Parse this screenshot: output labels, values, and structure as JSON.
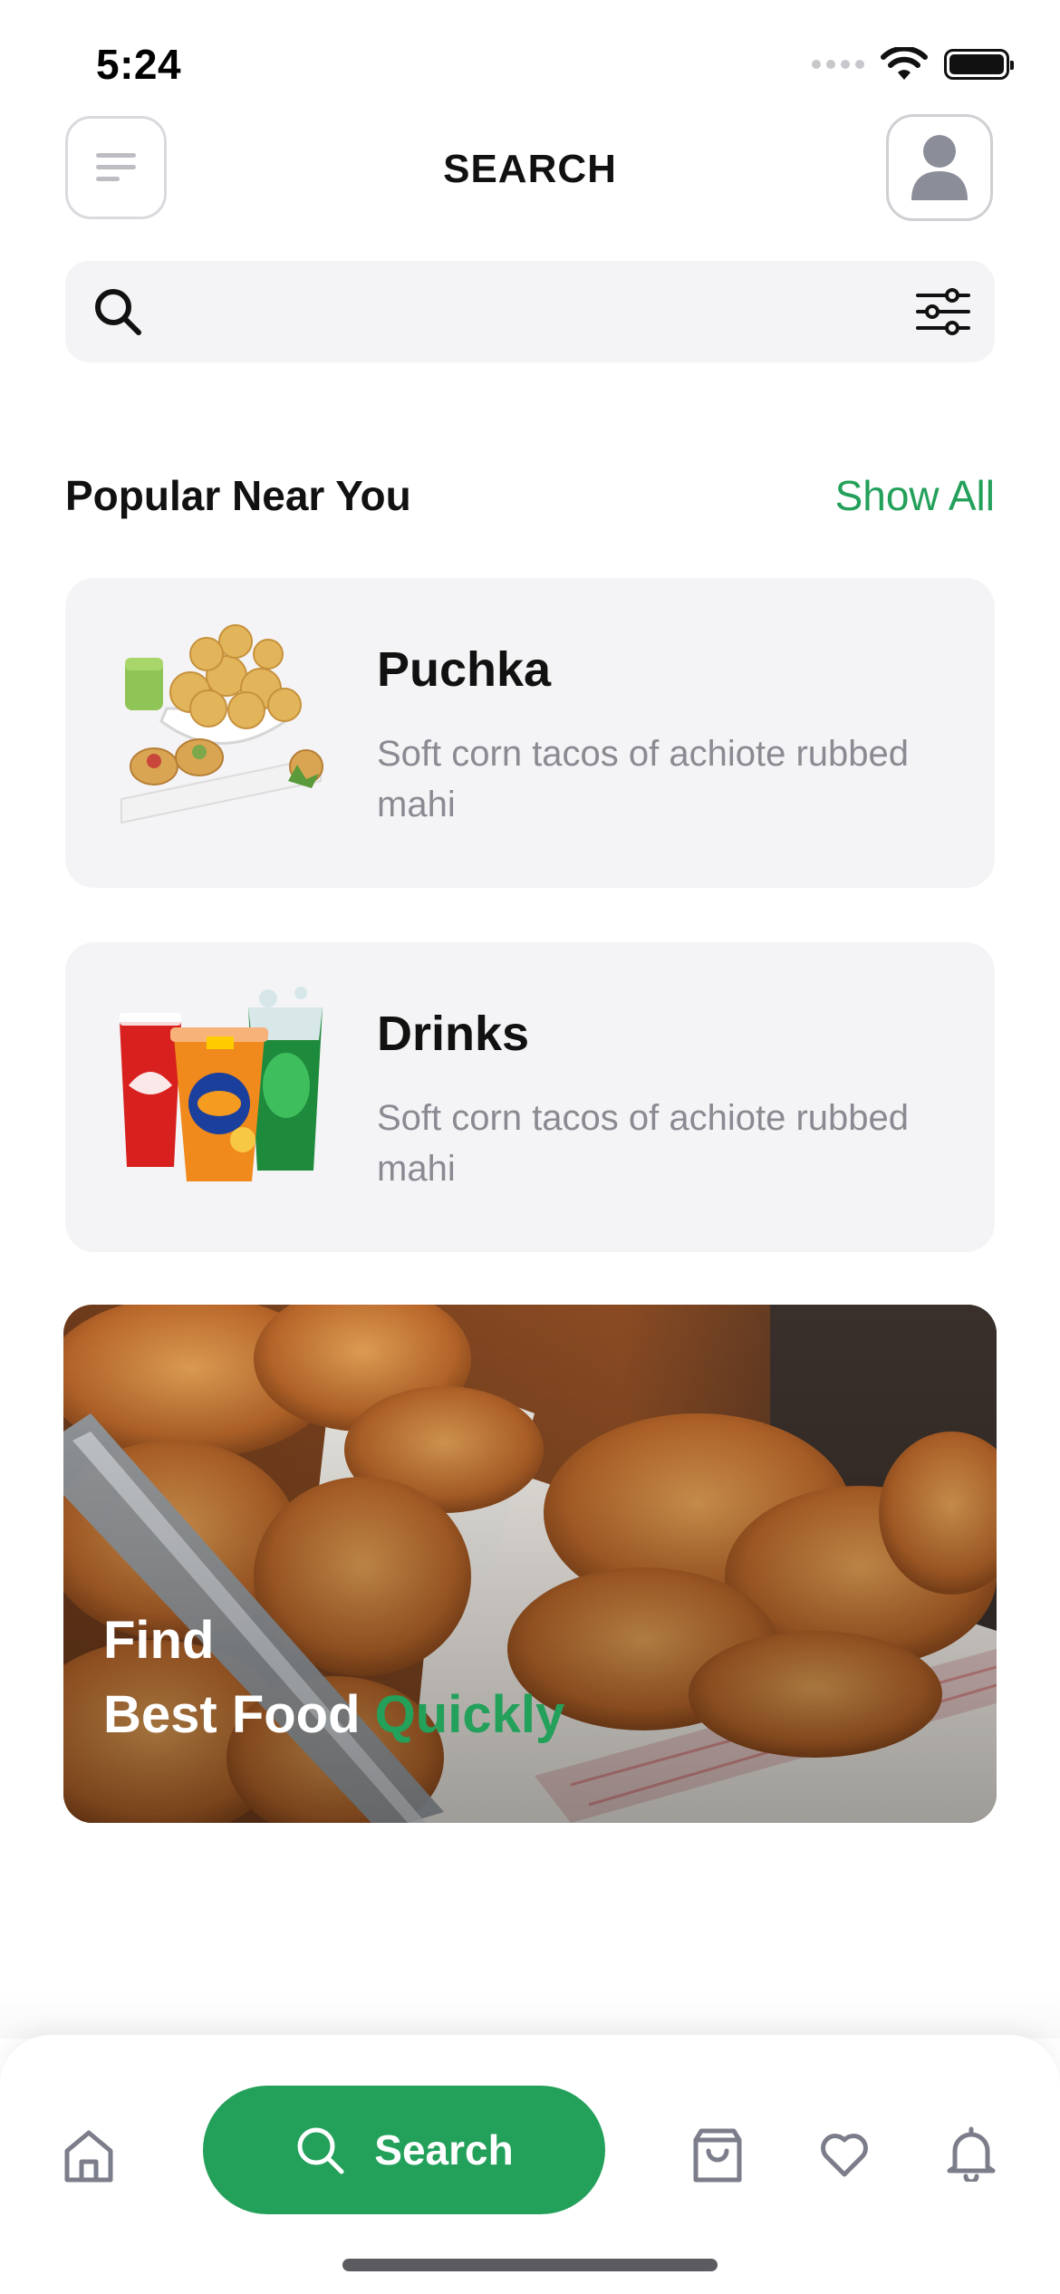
{
  "status_bar": {
    "time": "5:24"
  },
  "header": {
    "title": "SEARCH"
  },
  "search": {
    "placeholder": "",
    "value": ""
  },
  "section": {
    "title": "Popular Near You",
    "action": "Show All"
  },
  "items": [
    {
      "title": "Puchka",
      "description": "Soft corn tacos of achiote rubbed mahi"
    },
    {
      "title": "Drinks",
      "description": "Soft corn tacos of achiote rubbed mahi"
    }
  ],
  "promo": {
    "line1": "Find",
    "line2_prefix": "Best Food ",
    "line2_accent": "Quickly"
  },
  "nav": {
    "search_label": "Search"
  },
  "colors": {
    "accent": "#23a05a",
    "card_bg": "#f4f4f6",
    "muted_text": "#8a8a92"
  }
}
